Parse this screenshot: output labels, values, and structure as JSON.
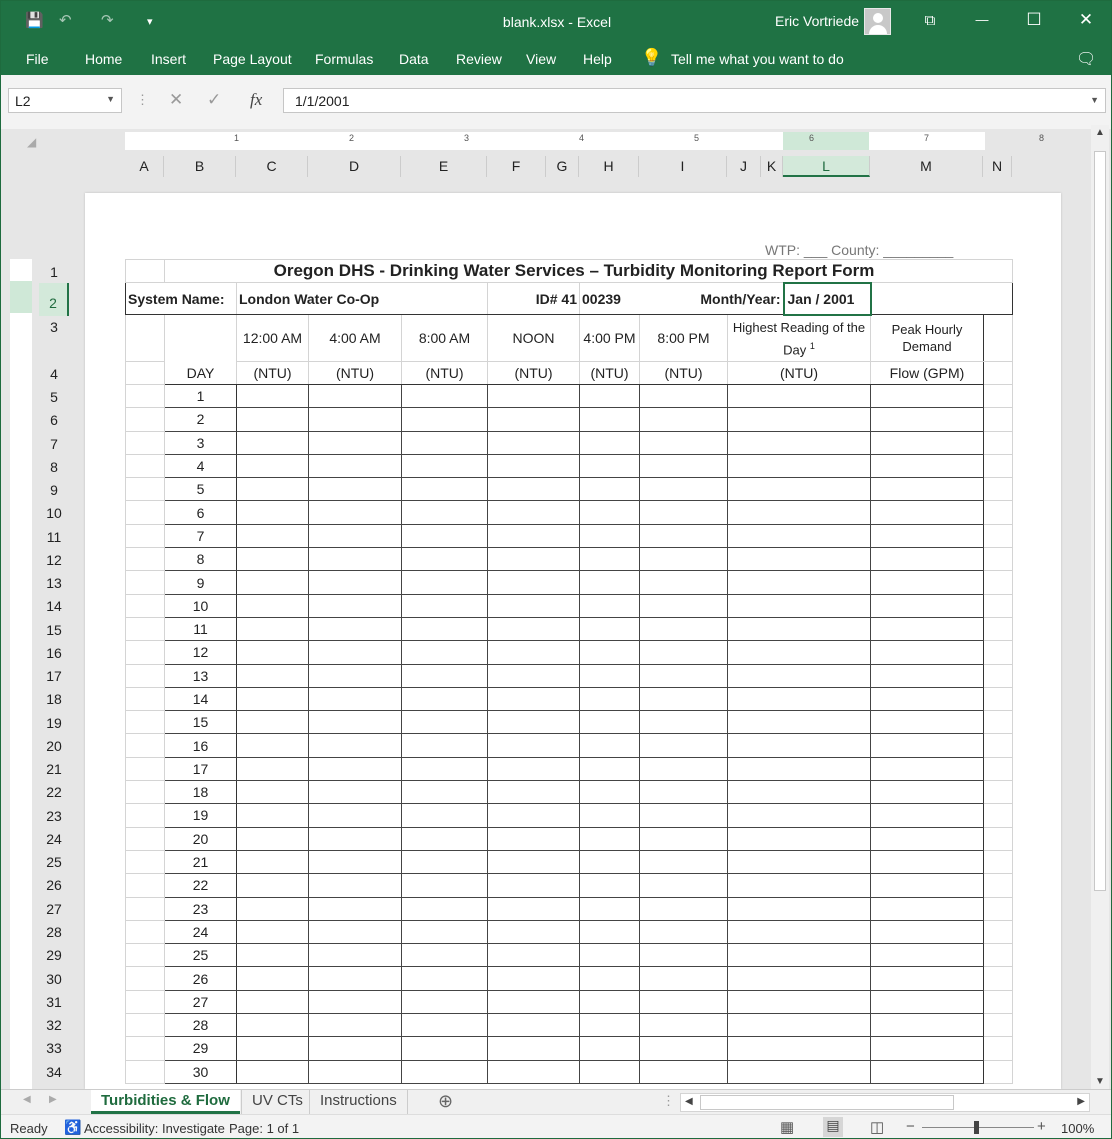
{
  "window": {
    "title": "blank.xlsx  -  Excel",
    "user": "Eric Vortriede"
  },
  "qat": {
    "save": "💾",
    "undo": "↶",
    "redo": "↷",
    "customize": "▾"
  },
  "winbtns": {
    "ribbon": "⧉",
    "minimize": "—",
    "maximize": "☐",
    "close": "✕"
  },
  "menu": [
    "File",
    "Home",
    "Insert",
    "Page Layout",
    "Formulas",
    "Data",
    "Review",
    "View",
    "Help"
  ],
  "tell_me": "Tell me what you want to do",
  "namebox": "L2",
  "formula": "1/1/2001",
  "fx": {
    "cancel": "✕",
    "enter": "✓",
    "fx": "fx"
  },
  "ruler": [
    "1",
    "2",
    "3",
    "4",
    "5",
    "6",
    "7",
    "8"
  ],
  "columns": [
    "A",
    "B",
    "C",
    "D",
    "E",
    "F",
    "G",
    "H",
    "I",
    "J",
    "K",
    "L",
    "M",
    "N"
  ],
  "rows": [
    "1",
    "2",
    "3",
    "4",
    "5",
    "6",
    "7",
    "8",
    "9",
    "10",
    "11",
    "12",
    "13",
    "14",
    "15",
    "16",
    "17",
    "18",
    "19",
    "20",
    "21",
    "22",
    "23",
    "24",
    "25",
    "26",
    "27",
    "28",
    "29",
    "30",
    "31",
    "32",
    "33",
    "34"
  ],
  "form": {
    "top_note": "WTP: ___   County: _________",
    "title": "Oregon DHS - Drinking Water Services – Turbidity Monitoring Report Form",
    "system_label": "System Name:",
    "system_value": "London Water Co-Op",
    "id_label": "ID# 41",
    "id_value": "00239",
    "month_label": "Month/Year:",
    "month_value": "Jan / 2001",
    "day_header": "DAY",
    "times": [
      "12:00 AM",
      "4:00 AM",
      "8:00 AM",
      "NOON",
      "4:00 PM",
      "8:00 PM"
    ],
    "highest": "Highest Reading of the Day",
    "highest_sup": "1",
    "peak": "Peak Hourly Demand",
    "unit": "(NTU)",
    "flow_unit": "Flow (GPM)",
    "days": [
      "1",
      "2",
      "3",
      "4",
      "5",
      "6",
      "7",
      "8",
      "9",
      "10",
      "11",
      "12",
      "13",
      "14",
      "15",
      "16",
      "17",
      "18",
      "19",
      "20",
      "21",
      "22",
      "23",
      "24",
      "25",
      "26",
      "27",
      "28",
      "29",
      "30"
    ]
  },
  "tabs": [
    "Turbidities & Flow",
    "UV CTs",
    "Instructions"
  ],
  "add_sheet": "⊕",
  "status": {
    "ready": "Ready",
    "accessibility": "Accessibility: Investigate",
    "page": "Page: 1 of 1",
    "zoom": "100%"
  }
}
